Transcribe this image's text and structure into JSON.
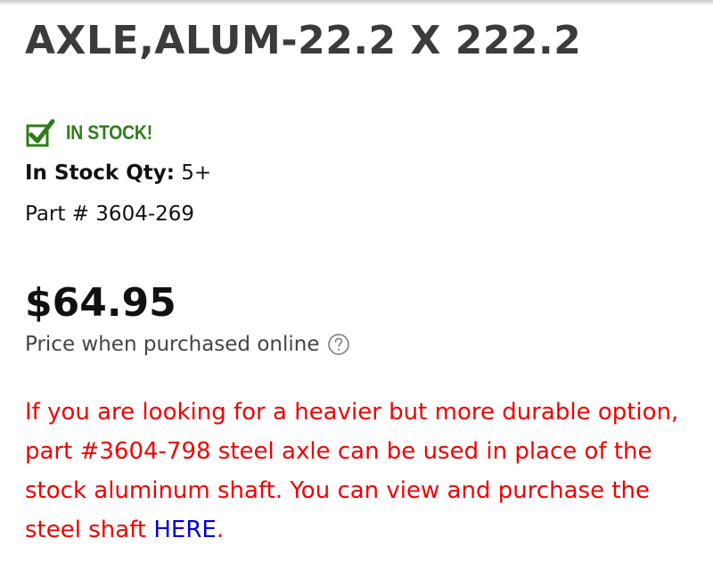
{
  "product": {
    "title": "AXLE,ALUM-22.2 X 222.2",
    "stock_badge": "IN STOCK!",
    "stock_qty_label": "In Stock Qty:",
    "stock_qty_value": " 5+",
    "part_number_text": "Part # 3604-269",
    "price": "$64.95",
    "price_note": "Price when purchased online"
  },
  "note": {
    "text": "If you are looking for a heavier but more durable option, part #3604-798 steel axle can be used in place of the stock aluminum shaft. You can view and purchase the steel shaft ",
    "link_label": "HERE",
    "suffix": "."
  },
  "icons": {
    "stock": "checkbox-check-icon",
    "help": "question-circle-icon"
  },
  "colors": {
    "title": "#3b3b3b",
    "stock_green": "#2f7d1a",
    "note_red": "#f20000",
    "link_blue": "#0000dd"
  }
}
